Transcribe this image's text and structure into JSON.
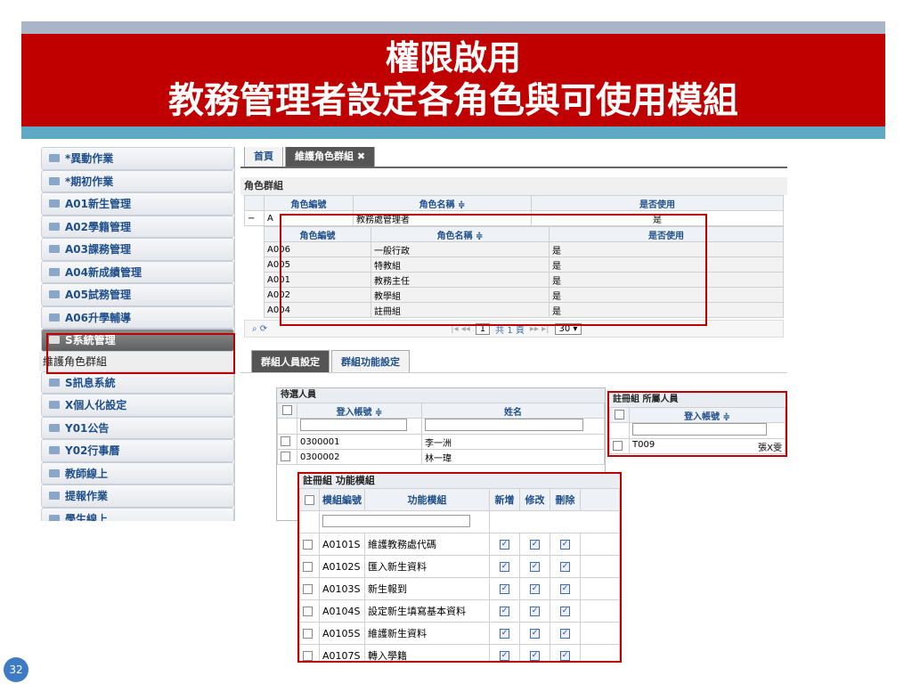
{
  "slide": {
    "title1": "權限啟用",
    "title2": "教務管理者設定各角色與可使用模組",
    "page": "32"
  },
  "sidebar": {
    "items": [
      "*異動作業",
      "*期初作業",
      "A01新生管理",
      "A02學籍管理",
      "A03課務管理",
      "A04新成績管理",
      "A05試務管理",
      "A06升學輔導"
    ],
    "open_item": "S系統管理",
    "sub_item": "維護角色群組",
    "items2": [
      "S訊息系統",
      "X個人化設定",
      "Y01公告",
      "Y02行事曆",
      "教師線上",
      "提報作業",
      "學生線上"
    ]
  },
  "tabs": {
    "home": "首頁",
    "role": "維護角色群組",
    "close": "✖"
  },
  "role_group": {
    "title": "角色群組",
    "headers": [
      "角色編號",
      "角色名稱 ≑",
      "是否使用"
    ],
    "parent": {
      "toggle": "−",
      "id": "A",
      "name": "教務處管理者",
      "use": "是"
    },
    "sub_headers": [
      "角色編號",
      "角色名稱 ≑",
      "是否使用"
    ],
    "rows": [
      [
        "A006",
        "一般行政",
        "是"
      ],
      [
        "A005",
        "特教組",
        "是"
      ],
      [
        "A001",
        "教務主任",
        "是"
      ],
      [
        "A002",
        "教學組",
        "是"
      ],
      [
        "A004",
        "註冊組",
        "是"
      ]
    ]
  },
  "pager": {
    "icons": "⌕ ⟳",
    "nav_prev": "|◂ ◂◂",
    "page": "1",
    "total": "共 1 頁",
    "nav_next": "▸▸ ▸|",
    "size": "30"
  },
  "sub_tabs": {
    "a": "群組人員設定",
    "b": "群組功能設定"
  },
  "pending": {
    "title": "待選人員",
    "headers": [
      "登入帳號 ≑",
      "姓名"
    ],
    "rows": [
      [
        "0300001",
        "李一洲"
      ],
      [
        "0300002",
        "林一瑋"
      ]
    ]
  },
  "members": {
    "title": "註冊組 所屬人員",
    "headers": [
      "登入帳號 ≑"
    ],
    "rows": [
      [
        "T009",
        "張X雯"
      ]
    ]
  },
  "functions": {
    "title": "註冊組 功能模組",
    "headers": [
      "模組編號",
      "功能模組",
      "新增",
      "修改",
      "刪除"
    ],
    "rows": [
      [
        "A0101S",
        "維護教務處代碼"
      ],
      [
        "A0102S",
        "匯入新生資料"
      ],
      [
        "A0103S",
        "新生報到"
      ],
      [
        "A0104S",
        "設定新生填寫基本資料"
      ],
      [
        "A0105S",
        "維護新生資料"
      ],
      [
        "A0107S",
        "轉入學籍"
      ]
    ],
    "check": "✓"
  }
}
